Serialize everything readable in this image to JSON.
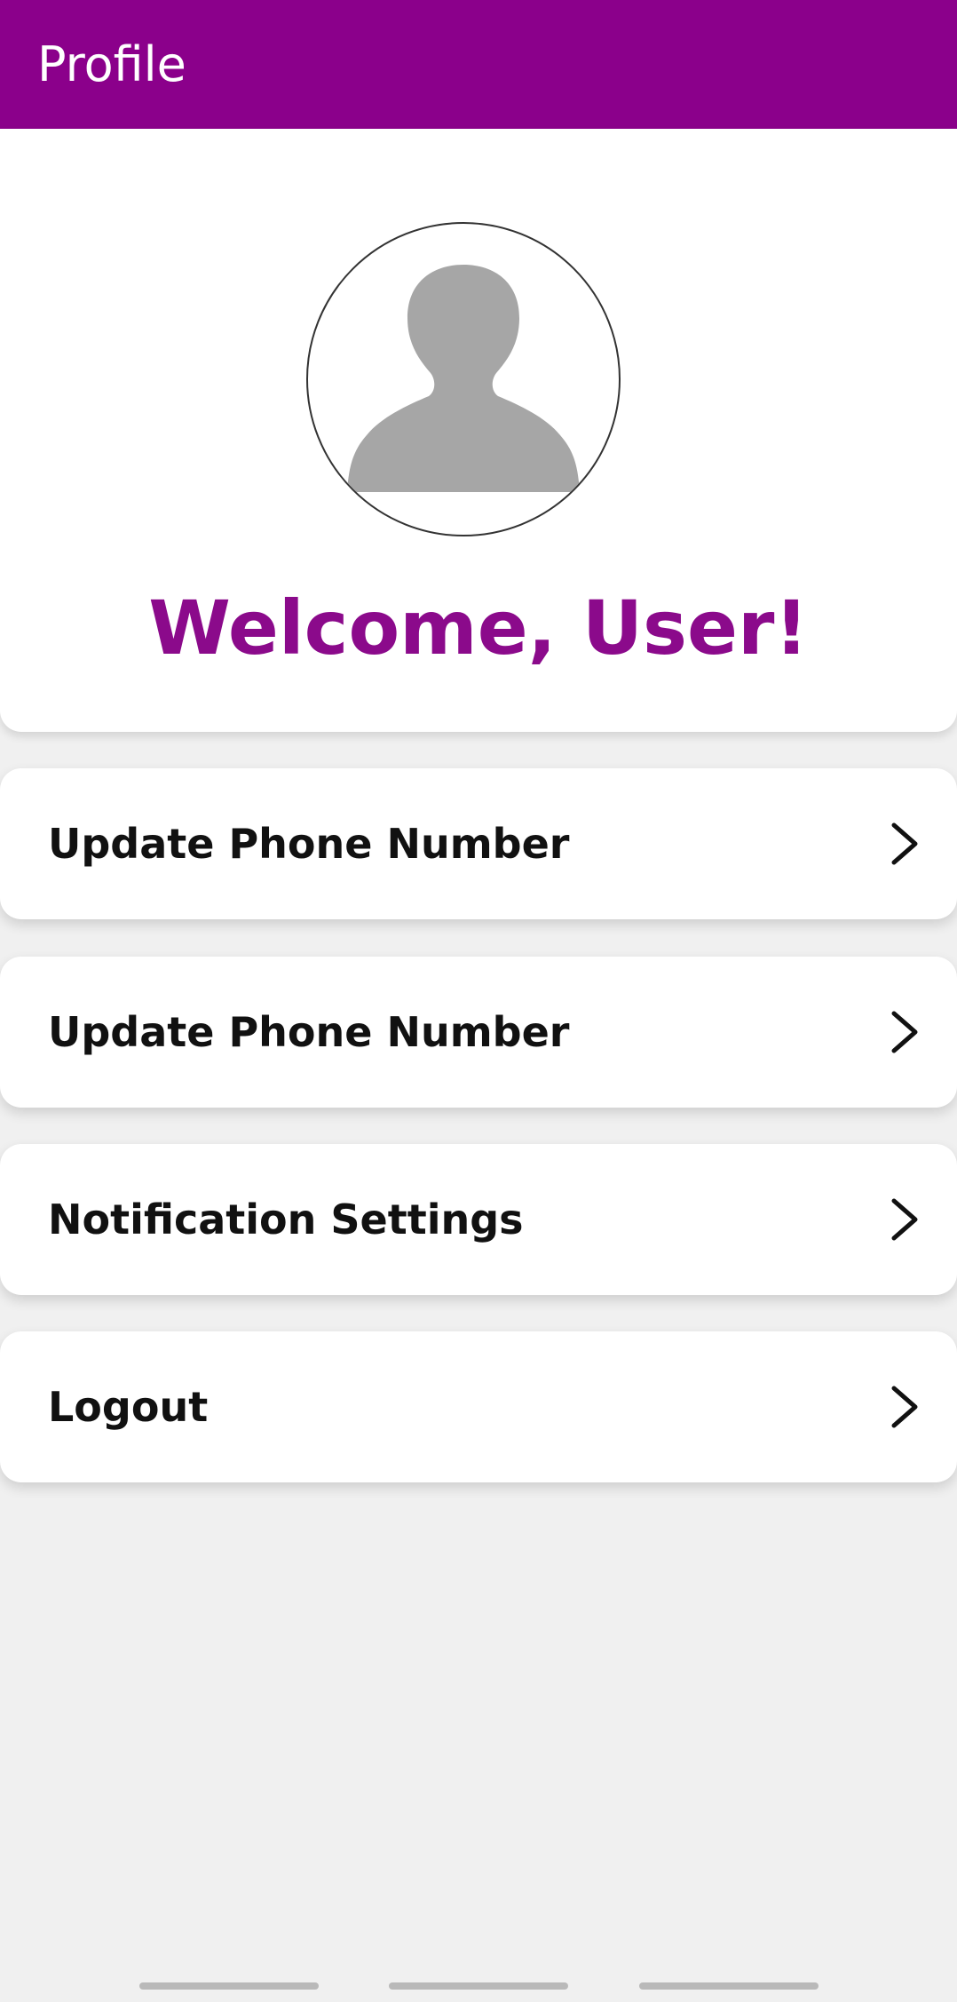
{
  "header": {
    "title": "Profile",
    "background_color": "#8b008b"
  },
  "profile": {
    "avatar_icon": "person-placeholder-icon",
    "welcome_text": "Welcome, User!",
    "accent_color": "#8b0a8b"
  },
  "menu": {
    "items": [
      {
        "label": "Update Phone Number",
        "icon": "chevron-right-icon"
      },
      {
        "label": "Update Phone Number",
        "icon": "chevron-right-icon"
      },
      {
        "label": "Notification Settings",
        "icon": "chevron-right-icon"
      },
      {
        "label": "Logout",
        "icon": "chevron-right-icon"
      }
    ]
  },
  "system_nav": {
    "handles": 3
  }
}
